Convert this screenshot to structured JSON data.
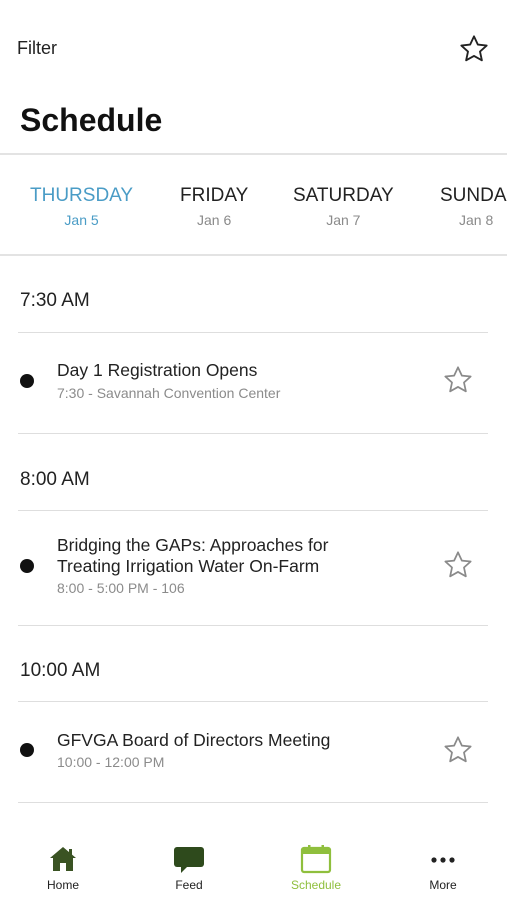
{
  "topbar": {
    "filter_label": "Filter",
    "favorite_icon": "star-outline-icon"
  },
  "page": {
    "title": "Schedule"
  },
  "days": [
    {
      "name": "THURSDAY",
      "date": "Jan 5",
      "active": true
    },
    {
      "name": "FRIDAY",
      "date": "Jan 6",
      "active": false
    },
    {
      "name": "SATURDAY",
      "date": "Jan 7",
      "active": false
    },
    {
      "name": "SUNDA",
      "date": "Jan 8",
      "active": false
    }
  ],
  "sections": [
    {
      "time": "7:30 AM",
      "sessions": [
        {
          "title": "Day 1 Registration Opens",
          "subtitle": "7:30 - Savannah Convention Center"
        }
      ]
    },
    {
      "time": "8:00 AM",
      "sessions": [
        {
          "title_line1": "Bridging the GAPs: Approaches for",
          "title_line2": "Treating Irrigation Water On-Farm",
          "subtitle": "8:00 - 5:00 PM - 106"
        }
      ]
    },
    {
      "time": "10:00 AM",
      "sessions": [
        {
          "title": "GFVGA Board of Directors Meeting",
          "subtitle": "10:00 - 12:00 PM"
        }
      ]
    }
  ],
  "tabbar": {
    "items": [
      {
        "label": "Home",
        "icon": "home-icon"
      },
      {
        "label": "Feed",
        "icon": "chat-bubble-icon"
      },
      {
        "label": "Schedule",
        "icon": "calendar-icon",
        "active": true
      },
      {
        "label": "More",
        "icon": "more-dots-icon"
      }
    ]
  },
  "colors": {
    "accent_blue": "#4a9cc6",
    "accent_green": "#8fbf3d",
    "feed_green": "#2e4a1c",
    "home_green": "#3a5323"
  }
}
